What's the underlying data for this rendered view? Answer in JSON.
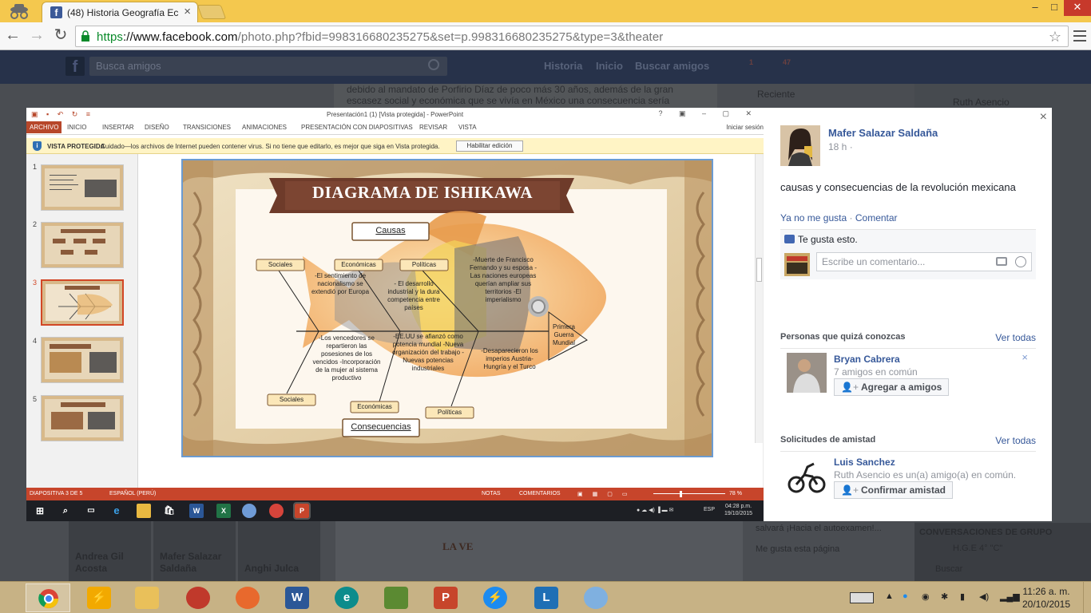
{
  "browser": {
    "tab_title": "(48) Historia Geografía Ec",
    "url_https": "https",
    "url_host": "://www.facebook.com",
    "url_rest": "/photo.php?fbid=998316680235275&set=p.998316680235275&type=3&theater"
  },
  "fb": {
    "search_placeholder": "Busca amigos",
    "nav_history": "Historia",
    "nav_home": "Inicio",
    "nav_find": "Buscar amigos",
    "notif_badges": [
      "1",
      "47"
    ],
    "feed_text": "debido al mandato de Porfirio Díaz de poco más 30 años, además de la gran escasez social y económica que se vivía en México una consecuencia sería",
    "recent_label": "Reciente",
    "sidebar_person": "Ruth Asencio",
    "friends_under": [
      "Andrea Gil Acosta",
      "Mafer Salazar Saldaña",
      "Anghi Julca"
    ],
    "mid_under_text": "LA VE",
    "side_under_1": "salvará ¡Hacia el autoexamen!...",
    "side_under_2": "Me gusta esta página",
    "group_label": "CONVERSACIONES DE GRUPO",
    "group_name": "H.G.E 4° \"C\"",
    "chat_search": "Buscar"
  },
  "ppt": {
    "title": "Presentación1 (1) [Vista protegida] - PowerPoint",
    "ribbon_tabs": [
      "ARCHIVO",
      "INICIO",
      "INSERTAR",
      "DISEÑO",
      "TRANSICIONES",
      "ANIMACIONES",
      "PRESENTACIÓN CON DIAPOSITIVAS",
      "REVISAR",
      "VISTA"
    ],
    "login": "Iniciar sesión",
    "protected_label": "VISTA PROTEGIDA",
    "protected_msg": "Cuidado—los archivos de Internet pueden contener virus. Si no tiene que editarlo, es mejor que siga en Vista protegida.",
    "enable_btn": "Habilitar edición",
    "slide_numbers": [
      "1",
      "2",
      "3",
      "4",
      "5"
    ],
    "status_slide": "DIAPOSITIVA 3 DE 5",
    "status_lang": "ESPAÑOL (PERÚ)",
    "status_notes": "NOTAS",
    "status_comments": "COMENTARIOS",
    "zoom": "78 %",
    "inner_clock_time": "04:28 p.m.",
    "inner_clock_date": "19/10/2015",
    "inner_lang": "ESP"
  },
  "diagram": {
    "title": "DIAGRAMA DE ISHIKAWA",
    "top_label": "Causas",
    "bottom_label": "Consecuencias",
    "head": "Primera Guerra Mundial",
    "cat_top": [
      "Sociales",
      "Económicas",
      "Políticas"
    ],
    "cat_bottom": [
      "Sociales",
      "Económicas",
      "Políticas"
    ],
    "cause_social": "-El sentimiento de nacionalismo se extendió por Europa",
    "cause_econ": "- El desarrollo industrial y la dura competencia entre países",
    "cause_polit": "-Muerte de Francisco Fernando y su esposa -Las naciones europeas querían ampliar sus territorios -El imperialismo",
    "cons_social": "-Los vencedores se repartieron las posesiones de los vencidos -Incorporación de la mujer al sistema productivo",
    "cons_econ": "-EE.UU se afianzó como potencia mundial -Nueva organización del trabajo -Nuevas potencias industriales",
    "cons_polit": "-Desaparecieron los imperios Austria-Hungría y el Turco"
  },
  "panel": {
    "author": "Mafer Salazar Saldaña",
    "time": "18 h ·",
    "caption": "causas y consecuencias de la revolución mexicana",
    "unlike": "Ya no me gusta",
    "sep": "·",
    "comment_link": "Comentar",
    "likes_text": "Te gusta esto.",
    "comment_placeholder": "Escribe un comentario...",
    "pymk_title": "Personas que quizá conozcas",
    "see_all": "Ver todas",
    "pymk_name": "Bryan Cabrera",
    "pymk_sub": "7 amigos en común",
    "add_btn": "Agregar a amigos",
    "req_title": "Solicitudes de amistad",
    "req_name": "Luis Sanchez",
    "req_sub": "Ruth Asencio es un(a) amigo(a) en común.",
    "confirm_btn": "Confirmar amistad"
  },
  "taskbar": {
    "clock_time": "11:26 a. m.",
    "clock_date": "20/10/2015"
  }
}
